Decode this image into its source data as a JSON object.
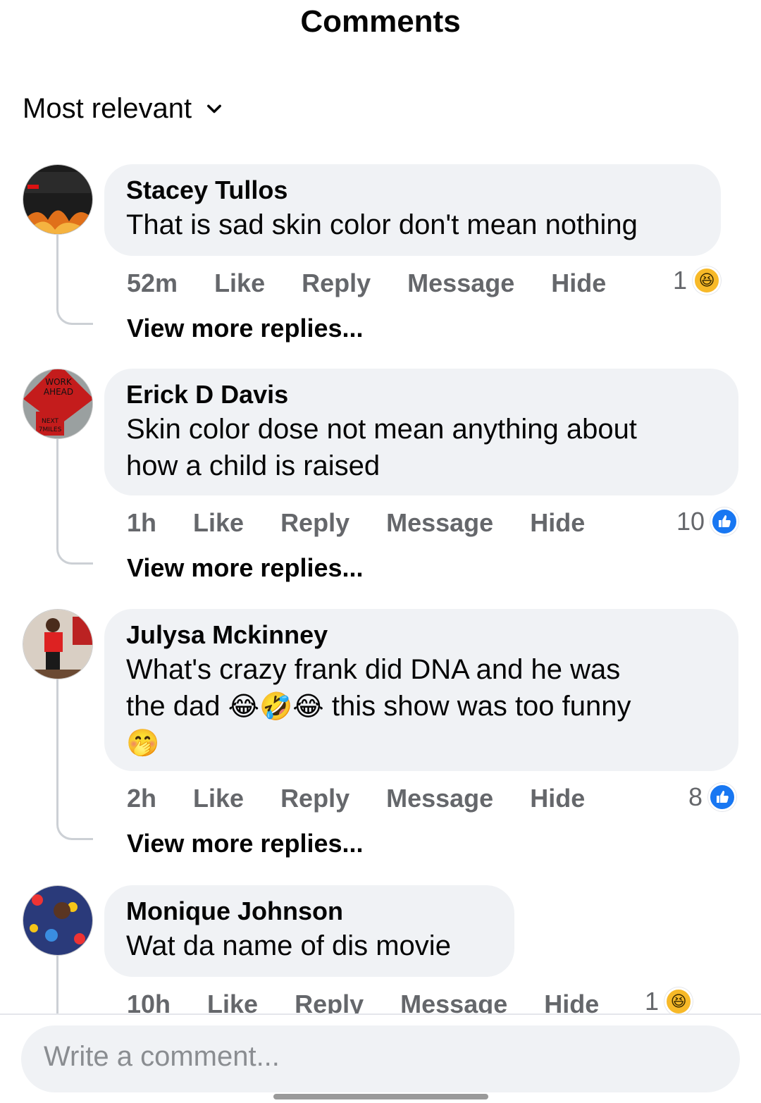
{
  "header": {
    "title": "Comments"
  },
  "sort": {
    "label": "Most relevant"
  },
  "comments": [
    {
      "name": "Stacey Tullos",
      "text": "That is sad skin color don't mean nothing",
      "time": "52m",
      "reaction_count": "1",
      "reaction_type": "haha"
    },
    {
      "name": "Erick D Davis",
      "text_line1": "Skin color dose not mean anything about",
      "text_line2": "how a child is raised",
      "time": "1h",
      "reaction_count": "10",
      "reaction_type": "like"
    },
    {
      "name": "Julysa Mckinney",
      "text_line1": "What's crazy frank did DNA and he was",
      "text_line2a": "the dad",
      "emojis": "😂🤣😂",
      "text_line2b": "this show was too funny",
      "text_line3": "🤭",
      "time": "2h",
      "reaction_count": "8",
      "reaction_type": "like"
    },
    {
      "name": "Monique Johnson",
      "text": "Wat da name of dis movie",
      "time": "10h",
      "reaction_count": "1",
      "reaction_type": "haha"
    }
  ],
  "actions": {
    "like": "Like",
    "reply": "Reply",
    "message": "Message",
    "hide": "Hide"
  },
  "view_more": "View more replies...",
  "composer": {
    "placeholder": "Write a comment..."
  },
  "icons": {
    "sort": "chevron-down-icon",
    "like": "thumbs-up-icon",
    "haha": "laughing-face-icon"
  },
  "colors": {
    "bubble": "#f0f2f5",
    "like_blue": "#1877f2",
    "secondary_text": "#65676b"
  }
}
